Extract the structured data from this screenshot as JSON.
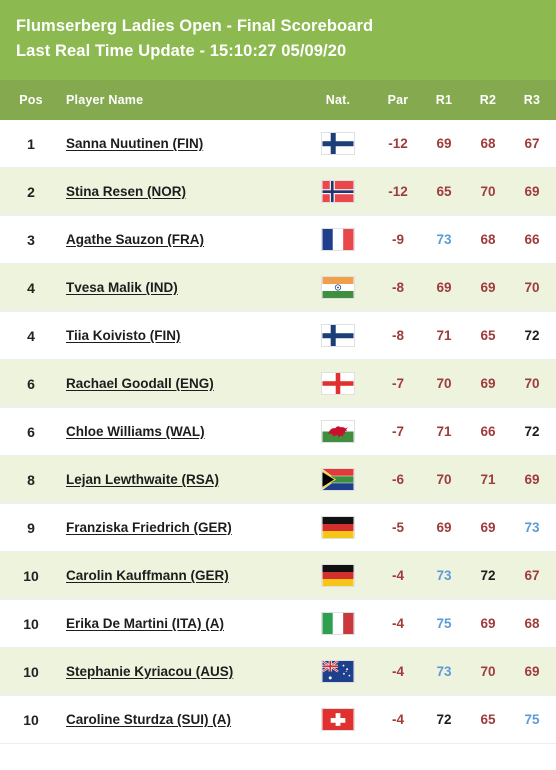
{
  "header": {
    "title_line1": "Flumserberg Ladies Open - Final Scoreboard",
    "title_line2": "Last Real Time Update - 15:10:27 05/09/20",
    "bar_color": "#8cb950",
    "columns_bar_color": "#85a94f"
  },
  "columns": {
    "pos": "Pos",
    "player_name": "Player Name",
    "nat": "Nat.",
    "par": "Par",
    "r1": "R1",
    "r2": "R2",
    "r3": "R3"
  },
  "legend_colors": {
    "under_par": "#9e3b3b",
    "level_par": "#1d1d1d",
    "over_par": "#5b9bd5"
  },
  "rows": [
    {
      "pos": "1",
      "name": "Sanna Nuutinen (FIN)",
      "flag": "fin",
      "par": "-12",
      "r1": "69",
      "r2": "68",
      "r3": "67",
      "r1_state": "under",
      "r2_state": "under",
      "r3_state": "under"
    },
    {
      "pos": "2",
      "name": "Stina Resen (NOR)",
      "flag": "nor",
      "par": "-12",
      "r1": "65",
      "r2": "70",
      "r3": "69",
      "r1_state": "under",
      "r2_state": "under",
      "r3_state": "under"
    },
    {
      "pos": "3",
      "name": "Agathe Sauzon (FRA)",
      "flag": "fra",
      "par": "-9",
      "r1": "73",
      "r2": "68",
      "r3": "66",
      "r1_state": "over",
      "r2_state": "under",
      "r3_state": "under"
    },
    {
      "pos": "4",
      "name": "Tvesa Malik (IND)",
      "flag": "ind",
      "par": "-8",
      "r1": "69",
      "r2": "69",
      "r3": "70",
      "r1_state": "under",
      "r2_state": "under",
      "r3_state": "under"
    },
    {
      "pos": "4",
      "name": "Tiia Koivisto (FIN)",
      "flag": "fin",
      "par": "-8",
      "r1": "71",
      "r2": "65",
      "r3": "72",
      "r1_state": "under",
      "r2_state": "under",
      "r3_state": "level"
    },
    {
      "pos": "6",
      "name": "Rachael Goodall (ENG)",
      "flag": "eng",
      "par": "-7",
      "r1": "70",
      "r2": "69",
      "r3": "70",
      "r1_state": "under",
      "r2_state": "under",
      "r3_state": "under"
    },
    {
      "pos": "6",
      "name": "Chloe Williams (WAL)",
      "flag": "wal",
      "par": "-7",
      "r1": "71",
      "r2": "66",
      "r3": "72",
      "r1_state": "under",
      "r2_state": "under",
      "r3_state": "level"
    },
    {
      "pos": "8",
      "name": "Lejan Lewthwaite (RSA)",
      "flag": "rsa",
      "par": "-6",
      "r1": "70",
      "r2": "71",
      "r3": "69",
      "r1_state": "under",
      "r2_state": "under",
      "r3_state": "under"
    },
    {
      "pos": "9",
      "name": "Franziska Friedrich (GER)",
      "flag": "ger",
      "par": "-5",
      "r1": "69",
      "r2": "69",
      "r3": "73",
      "r1_state": "under",
      "r2_state": "under",
      "r3_state": "over"
    },
    {
      "pos": "10",
      "name": "Carolin Kauffmann (GER)",
      "flag": "ger",
      "par": "-4",
      "r1": "73",
      "r2": "72",
      "r3": "67",
      "r1_state": "over",
      "r2_state": "level",
      "r3_state": "under"
    },
    {
      "pos": "10",
      "name": "Erika De Martini (ITA) (A)",
      "flag": "ita",
      "par": "-4",
      "r1": "75",
      "r2": "69",
      "r3": "68",
      "r1_state": "over",
      "r2_state": "under",
      "r3_state": "under"
    },
    {
      "pos": "10",
      "name": "Stephanie Kyriacou (AUS)",
      "flag": "aus",
      "par": "-4",
      "r1": "73",
      "r2": "70",
      "r3": "69",
      "r1_state": "over",
      "r2_state": "under",
      "r3_state": "under"
    },
    {
      "pos": "10",
      "name": "Caroline Sturdza (SUI) (A)",
      "flag": "sui",
      "par": "-4",
      "r1": "72",
      "r2": "65",
      "r3": "75",
      "r1_state": "level",
      "r2_state": "under",
      "r3_state": "over"
    }
  ]
}
